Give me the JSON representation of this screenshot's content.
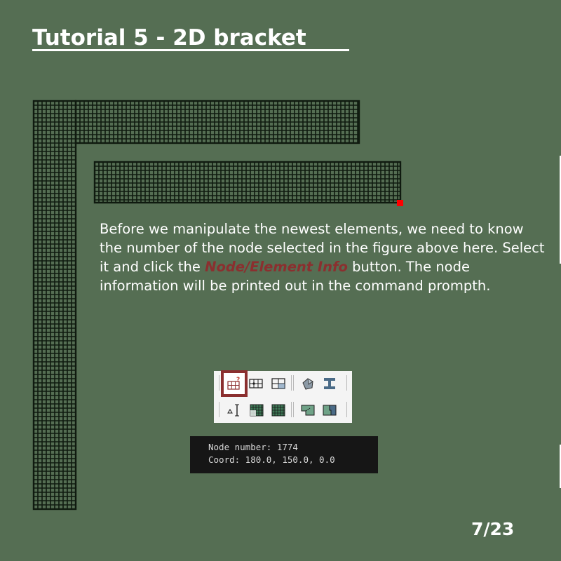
{
  "title": "Tutorial 5 - 2D bracket  ",
  "description": {
    "part1": "Before we manipulate the newest elements, we need to know the number of the node selected in the figure above here. Select it and click the ",
    "highlight": "Node/Element Info",
    "part2": " button. The node information will be printed out in the command prompth."
  },
  "toolbar": {
    "row1": [
      "node-element-info-icon",
      "node-mesh-icon",
      "element-mesh-icon",
      "geometry-icon",
      "section-beam-icon"
    ],
    "row2": [
      "dimension-icon",
      "mesh-refine-icon",
      "mesh-grid-icon",
      "surface-mesh-icon",
      "surface-split-icon"
    ],
    "active": "node-element-info-icon"
  },
  "console": {
    "line1": "Node number: 1774",
    "line2": "Coord: 180.0, 150.0, 0.0"
  },
  "page_indicator": "7/23",
  "colors": {
    "background": "#556e53",
    "mesh_line": "#0f1a0f",
    "highlight": "#8b2f2f",
    "selected_node": "#ff0000"
  }
}
